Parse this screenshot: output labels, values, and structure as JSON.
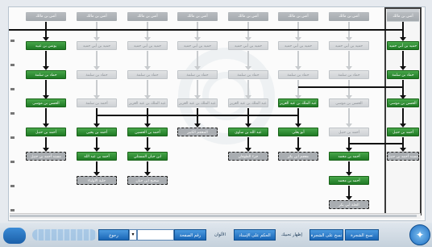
{
  "columns": [
    {
      "nodes": [
        "أنس بن مالك",
        "حميد بن أبي حميد",
        "حماد بن سلمة",
        "الحسن بن موسى",
        "أحمد بن حنبل",
        "مسند أحمد بن حنبل"
      ]
    },
    {
      "nodes": [
        "أنس بن مالك",
        "حميد بن أبي حميد",
        "حماد بن سلمة",
        "الحسن بن موسى",
        "أحمد بن حنبل",
        "أحمد بن محمد",
        "أحمد بن محمد",
        "الحلة أبي بكر"
      ]
    },
    {
      "nodes": [
        "أنس بن مالك",
        "حميد بن أبي حميد",
        "حماد بن سلمة",
        "عبد الملك بن عبد العزيز",
        "أبو يعلى",
        "معجم ابن بكر"
      ]
    },
    {
      "nodes": [
        "أنس بن مالك",
        "حميد بن أبي حميد",
        "حماد بن سلمة",
        "عبد الملك بن عبد العزيز",
        "عبد الله بن ساوي",
        "جزء الطوفان"
      ]
    },
    {
      "nodes": [
        "أنس بن مالك",
        "حميد بن أبي حميد",
        "حماد بن سلمة",
        "عبد الملك بن عبد العزيز",
        "المعجم الكبير"
      ]
    },
    {
      "nodes": [
        "أنس بن مالك",
        "حميد بن أبي حميد",
        "حماد بن سلمة",
        "عبد الملك بن عبد العزيز",
        "أحمد بن الحسين",
        "ابن حبان المستلي",
        "صحيح ابن حبان"
      ]
    },
    {
      "nodes": [
        "أنس بن مالك",
        "حميد بن أبي حميد",
        "حماد بن سلمة",
        "أحمد بن سلمة",
        "أحمد بن يحيى",
        "أحمد بن عبد الله",
        "حلية الأولياء"
      ]
    },
    {
      "nodes": [
        "أنس بن مالك",
        "يونس بن عبيد",
        "حماد بن سلمة",
        "الحسن بن موسى",
        "أحمد بن حنبل",
        "مسند أحمد بن حنبل"
      ]
    }
  ],
  "toolbar": {
    "back": "رجوع",
    "page_label": "رقم الصفحة",
    "colors": "الألوان",
    "judge": "الحكم على الإسناد",
    "show_narrators": "إظهار تحبيك",
    "copy_tree": "نسخ على الشجرة",
    "print_tree": "نسخ الشجرة"
  },
  "accent_colors": {
    "green": "#2e8b35",
    "gray": "#a4a9ae",
    "blue": "#1a66b6"
  }
}
